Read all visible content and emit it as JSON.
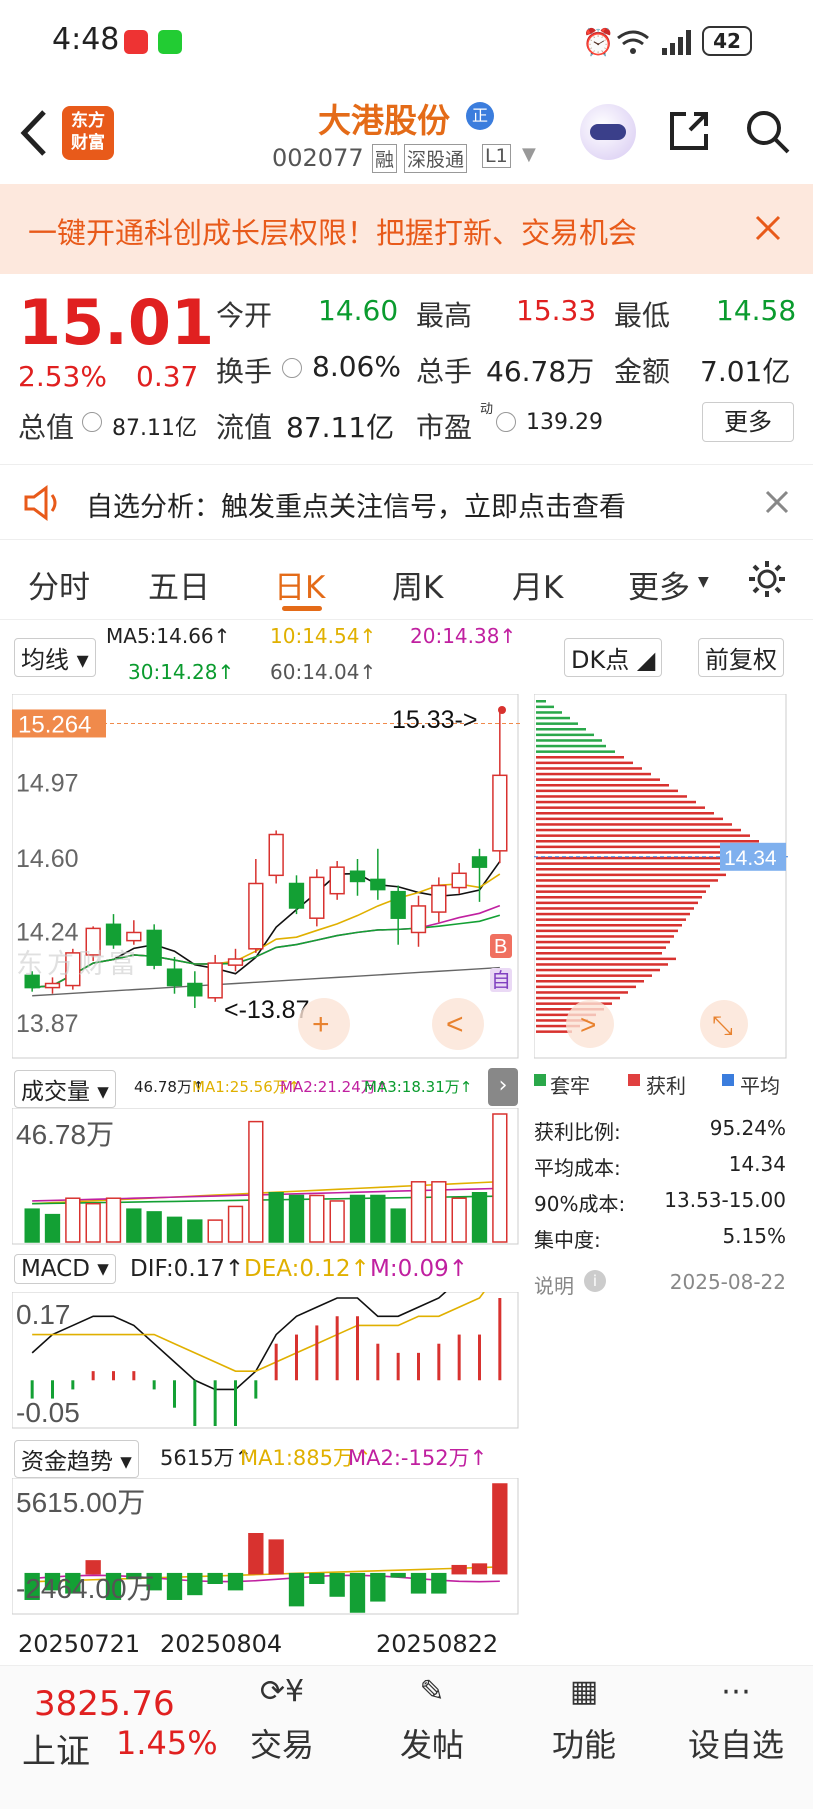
{
  "status": {
    "time": "4:48",
    "battery": "42"
  },
  "header": {
    "logo_line1": "东方",
    "logo_line2": "财富",
    "title": "大港股份",
    "badge": "正",
    "code": "002077",
    "tag1": "融",
    "tag2": "深股通",
    "tag3": "L1"
  },
  "banner": {
    "text": "一键开通科创成长层权限！把握打新、交易机会"
  },
  "quote": {
    "price": "15.01",
    "pct": "2.53%",
    "chg": "0.37",
    "open_label": "今开",
    "open": "14.60",
    "high_label": "最高",
    "high": "15.33",
    "low_label": "最低",
    "low": "14.58",
    "turn_label": "换手",
    "turn": "8.06%",
    "vol_label": "总手",
    "vol": "46.78万",
    "amt_label": "金额",
    "amt": "7.01亿",
    "mcap_label": "总值",
    "mcap": "87.11亿",
    "fcap_label": "流值",
    "fcap": "87.11亿",
    "pe_label": "市盈",
    "pe_sup": "动",
    "pe": "139.29",
    "more": "更多"
  },
  "notice": {
    "text": "自选分析：触发重点关注信号，立即点击查看"
  },
  "tabs": [
    "分时",
    "五日",
    "日K",
    "周K",
    "月K",
    "更多"
  ],
  "active_tab": "日K",
  "kline": {
    "selector": "均线",
    "ma5": "MA5:14.66↑",
    "ma10": "10:14.54↑",
    "ma20": "20:14.38↑",
    "ma30": "30:14.28↑",
    "ma60": "60:14.04↑",
    "cur_price_tag": "15.264",
    "y1": "14.97",
    "y2": "14.60",
    "y3": "14.24",
    "y4": "13.87",
    "high_marker": "15.33->",
    "low_marker": "<-13.87",
    "watermark": "东方财富",
    "b_tag": "B",
    "zi_tag": "自",
    "dk_button": "DK点",
    "fq_button": "前复权"
  },
  "chip": {
    "avg_tag": "14.34",
    "legend1": "套牢",
    "legend2": "获利",
    "legend3": "平均",
    "rows": [
      {
        "k": "获利比例:",
        "v": "95.24%"
      },
      {
        "k": "平均成本:",
        "v": "14.34"
      },
      {
        "k": "90%成本:",
        "v": "13.53-15.00"
      },
      {
        "k": "集中度:",
        "v": "5.15%"
      }
    ],
    "note": "说明",
    "date": "2025-08-22"
  },
  "volume": {
    "selector": "成交量",
    "vol": "46.78万↑",
    "ma1": "MA1:25.56万↑",
    "ma2": "MA2:21.24万↑",
    "ma3": "MA3:18.31万↑",
    "max": "46.78万"
  },
  "macd": {
    "selector": "MACD",
    "dif": "DIF:0.17↑",
    "dea": "DEA:0.12↑",
    "m": "M:0.09↑",
    "top": "0.17",
    "bottom": "-0.05"
  },
  "fund": {
    "selector": "资金趋势",
    "val": "5615万↑",
    "ma1": "MA1:885万↑",
    "ma2": "MA2:-152万↑",
    "top": "5615.00万",
    "bottom": "-2464.00万"
  },
  "dates": [
    "20250721",
    "20250804",
    "20250822"
  ],
  "chart_data": [
    {
      "type": "candlestick",
      "title": "",
      "categories_count": 24,
      "candles": [
        [
          14.03,
          13.97,
          14.05,
          13.95
        ],
        [
          13.97,
          13.99,
          14.02,
          13.94
        ],
        [
          13.98,
          14.14,
          14.16,
          13.96
        ],
        [
          14.13,
          14.26,
          14.27,
          14.1
        ],
        [
          14.28,
          14.18,
          14.33,
          14.16
        ],
        [
          14.2,
          14.24,
          14.3,
          14.18
        ],
        [
          14.25,
          14.08,
          14.28,
          14.06
        ],
        [
          14.06,
          13.98,
          14.12,
          13.94
        ],
        [
          13.99,
          13.93,
          14.05,
          13.87
        ],
        [
          13.92,
          14.09,
          14.13,
          13.9
        ],
        [
          14.08,
          14.11,
          14.16,
          14.05
        ],
        [
          14.16,
          14.48,
          14.6,
          14.14
        ],
        [
          14.52,
          14.72,
          14.74,
          14.48
        ],
        [
          14.48,
          14.36,
          14.52,
          14.33
        ],
        [
          14.31,
          14.51,
          14.55,
          14.27
        ],
        [
          14.43,
          14.56,
          14.59,
          14.4
        ],
        [
          14.54,
          14.49,
          14.6,
          14.42
        ],
        [
          14.5,
          14.45,
          14.65,
          14.4
        ],
        [
          14.44,
          14.31,
          14.47,
          14.18
        ],
        [
          14.24,
          14.37,
          14.42,
          14.17
        ],
        [
          14.34,
          14.47,
          14.51,
          14.29
        ],
        [
          14.46,
          14.53,
          14.58,
          14.43
        ],
        [
          14.61,
          14.56,
          14.65,
          14.39
        ],
        [
          14.64,
          15.01,
          15.33,
          14.58
        ]
      ],
      "ylim": [
        13.87,
        15.33
      ]
    },
    {
      "type": "bar",
      "title": "成交量",
      "values": [
        12,
        10,
        16,
        14,
        16,
        12,
        11,
        9,
        8,
        8,
        13,
        44,
        18,
        17,
        17,
        15,
        17,
        17,
        12,
        22,
        22,
        16,
        18,
        46.78
      ],
      "colors": [
        "g",
        "g",
        "r",
        "r",
        "r",
        "g",
        "g",
        "g",
        "g",
        "r",
        "r",
        "r",
        "g",
        "g",
        "r",
        "r",
        "g",
        "g",
        "g",
        "r",
        "r",
        "r",
        "g",
        "r"
      ]
    },
    {
      "type": "bar",
      "title": "MACD",
      "values": [
        -0.02,
        -0.02,
        -0.01,
        0.01,
        0.01,
        0.01,
        -0.01,
        -0.03,
        -0.05,
        -0.05,
        -0.05,
        -0.02,
        0.04,
        0.05,
        0.06,
        0.07,
        0.07,
        0.04,
        0.03,
        0.03,
        0.04,
        0.05,
        0.05,
        0.09
      ]
    },
    {
      "type": "bar",
      "title": "资金趋势",
      "values": [
        -1600,
        -1000,
        -1200,
        800,
        -1600,
        -300,
        -1000,
        -1600,
        -1300,
        -600,
        -1000,
        2500,
        2100,
        -2000,
        -600,
        -1400,
        -2400,
        -1700,
        -200,
        -1200,
        -1200,
        500,
        600,
        5615
      ]
    }
  ]
}
